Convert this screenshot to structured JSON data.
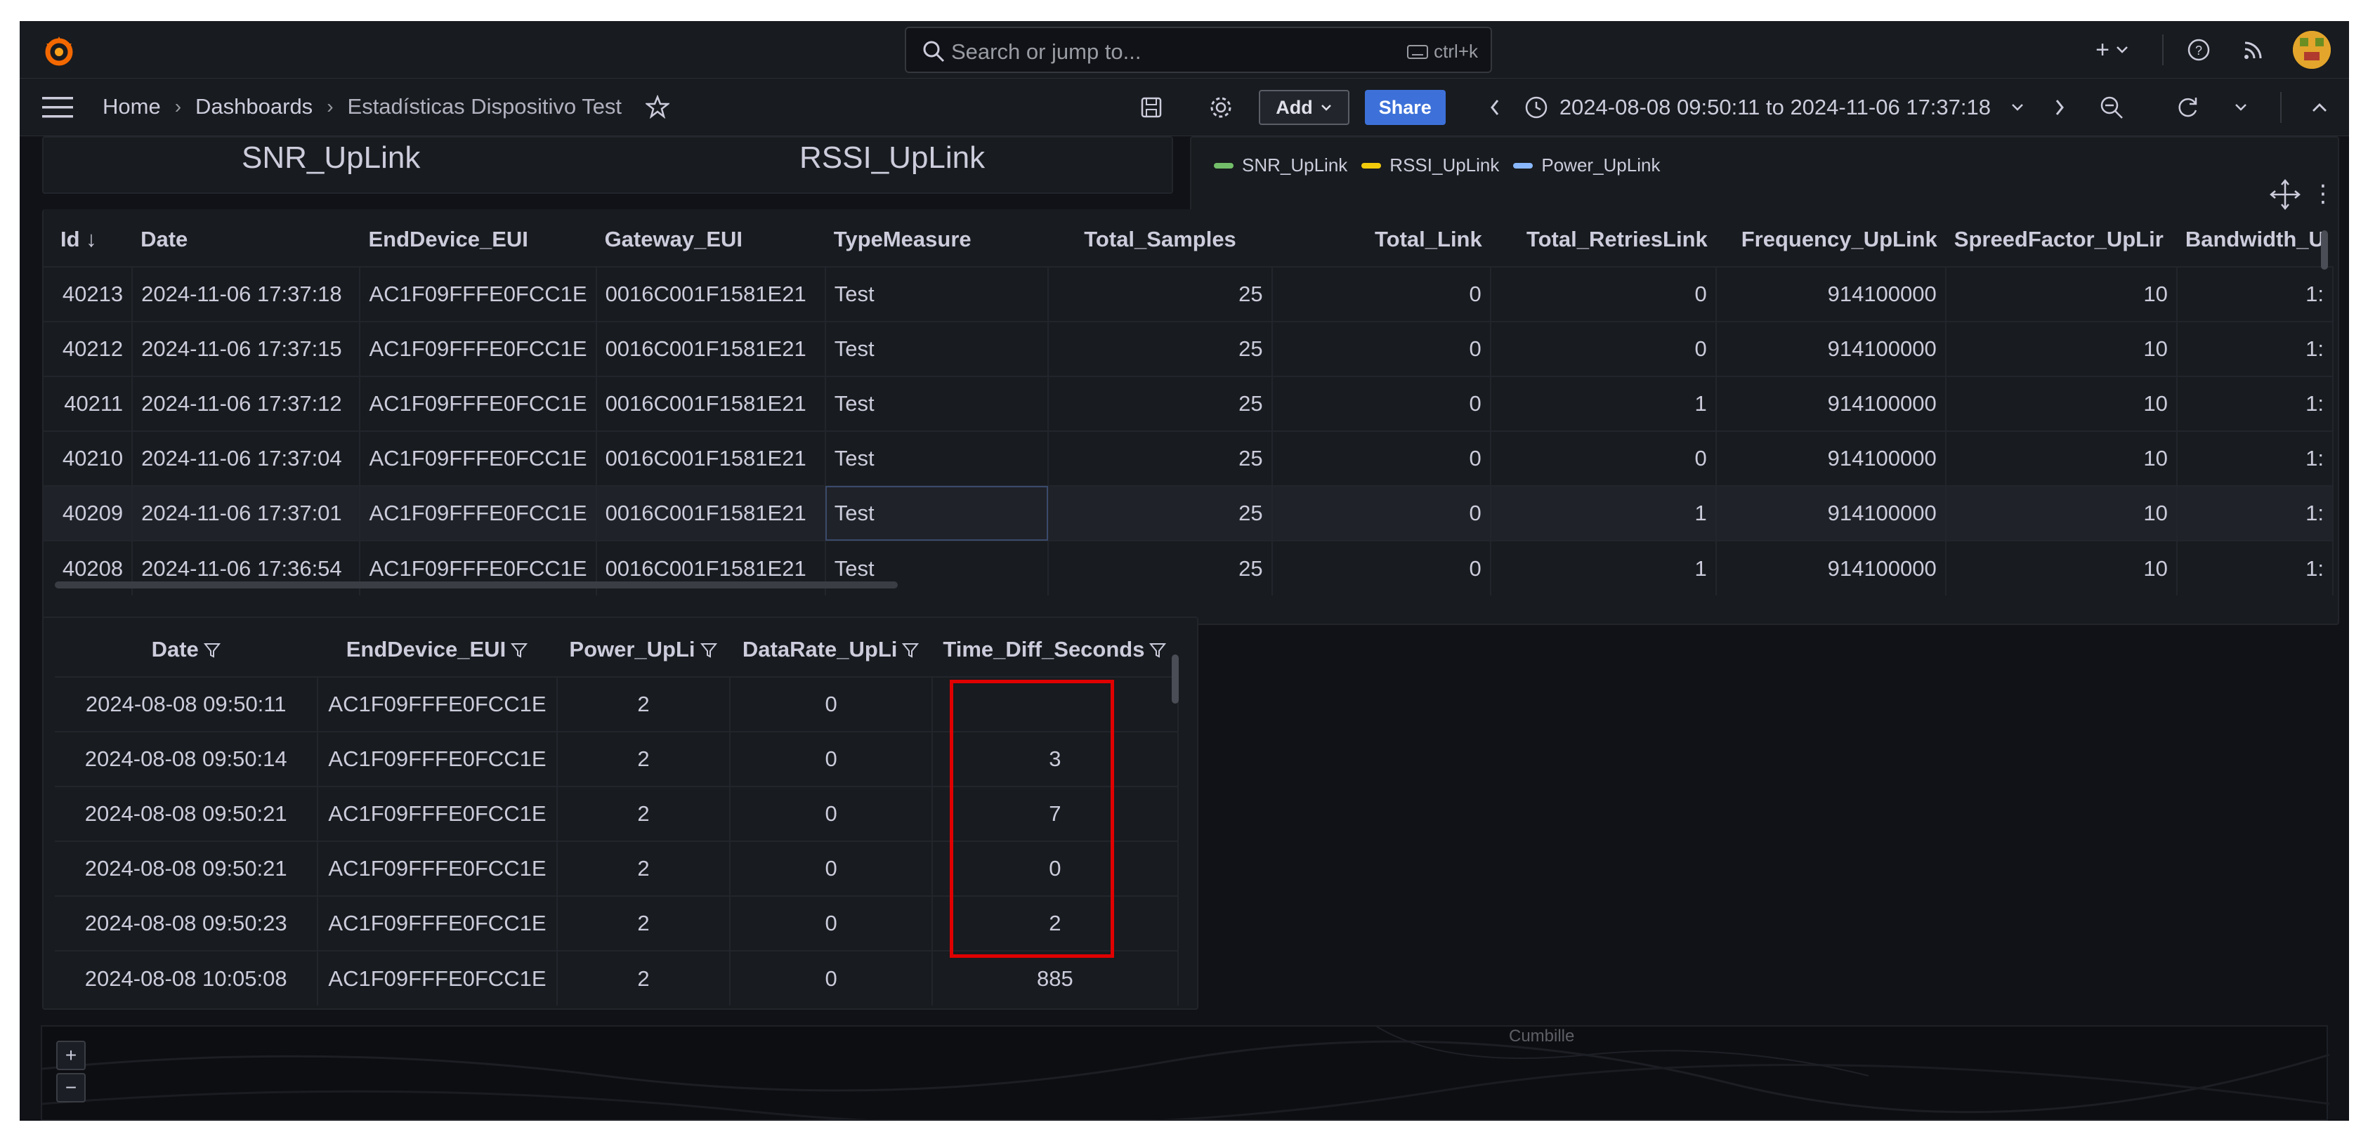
{
  "search": {
    "placeholder": "Search or jump to...",
    "shortcut": "ctrl+k"
  },
  "breadcrumb": {
    "home": "Home",
    "dashboards": "Dashboards",
    "current": "Estadísticas Dispositivo Test"
  },
  "toolbar": {
    "add_label": "Add",
    "share_label": "Share",
    "time_range": "2024-08-08 09:50:11 to 2024-11-06 17:37:18"
  },
  "stat_panels": {
    "snr_title": "SNR_UpLink",
    "rssi_title": "RSSI_UpLink"
  },
  "legend": [
    {
      "name": "SNR_UpLink",
      "color": "#73bf69"
    },
    {
      "name": "RSSI_UpLink",
      "color": "#f2cc0c"
    },
    {
      "name": "Power_UpLink",
      "color": "#8ab8ff"
    }
  ],
  "main_table": {
    "sort_indicator": "↓",
    "columns": [
      "Id",
      "Date",
      "EndDevice_EUI",
      "Gateway_EUI",
      "TypeMeasure",
      "Total_Samples",
      "Total_Link",
      "Total_RetriesLink",
      "Frequency_UpLink",
      "SpreedFactor_UpLir",
      "Bandwidth_U"
    ],
    "rows": [
      [
        "40213",
        "2024-11-06 17:37:18",
        "AC1F09FFFE0FCC1E",
        "0016C001F1581E21",
        "Test",
        "25",
        "0",
        "0",
        "914100000",
        "10",
        "1:"
      ],
      [
        "40212",
        "2024-11-06 17:37:15",
        "AC1F09FFFE0FCC1E",
        "0016C001F1581E21",
        "Test",
        "25",
        "0",
        "0",
        "914100000",
        "10",
        "1:"
      ],
      [
        "40211",
        "2024-11-06 17:37:12",
        "AC1F09FFFE0FCC1E",
        "0016C001F1581E21",
        "Test",
        "25",
        "0",
        "1",
        "914100000",
        "10",
        "1:"
      ],
      [
        "40210",
        "2024-11-06 17:37:04",
        "AC1F09FFFE0FCC1E",
        "0016C001F1581E21",
        "Test",
        "25",
        "0",
        "0",
        "914100000",
        "10",
        "1:"
      ],
      [
        "40209",
        "2024-11-06 17:37:01",
        "AC1F09FFFE0FCC1E",
        "0016C001F1581E21",
        "Test",
        "25",
        "0",
        "1",
        "914100000",
        "10",
        "1:"
      ],
      [
        "40208",
        "2024-11-06 17:36:54",
        "AC1F09FFFE0FCC1E",
        "0016C001F1581E21",
        "Test",
        "25",
        "0",
        "1",
        "914100000",
        "10",
        "1:"
      ]
    ]
  },
  "diff_table": {
    "columns": [
      "Date",
      "EndDevice_EUI",
      "Power_UpLi",
      "DataRate_UpLi",
      "Time_Diff_Seconds"
    ],
    "rows": [
      [
        "2024-08-08 09:50:11",
        "AC1F09FFFE0FCC1E",
        "2",
        "0",
        ""
      ],
      [
        "2024-08-08 09:50:14",
        "AC1F09FFFE0FCC1E",
        "2",
        "0",
        "3"
      ],
      [
        "2024-08-08 09:50:21",
        "AC1F09FFFE0FCC1E",
        "2",
        "0",
        "7"
      ],
      [
        "2024-08-08 09:50:21",
        "AC1F09FFFE0FCC1E",
        "2",
        "0",
        "0"
      ],
      [
        "2024-08-08 09:50:23",
        "AC1F09FFFE0FCC1E",
        "2",
        "0",
        "2"
      ],
      [
        "2024-08-08 10:05:08",
        "AC1F09FFFE0FCC1E",
        "2",
        "0",
        "885"
      ]
    ]
  },
  "map": {
    "label": "Cumbille",
    "zoom_in": "+",
    "zoom_out": "−"
  }
}
